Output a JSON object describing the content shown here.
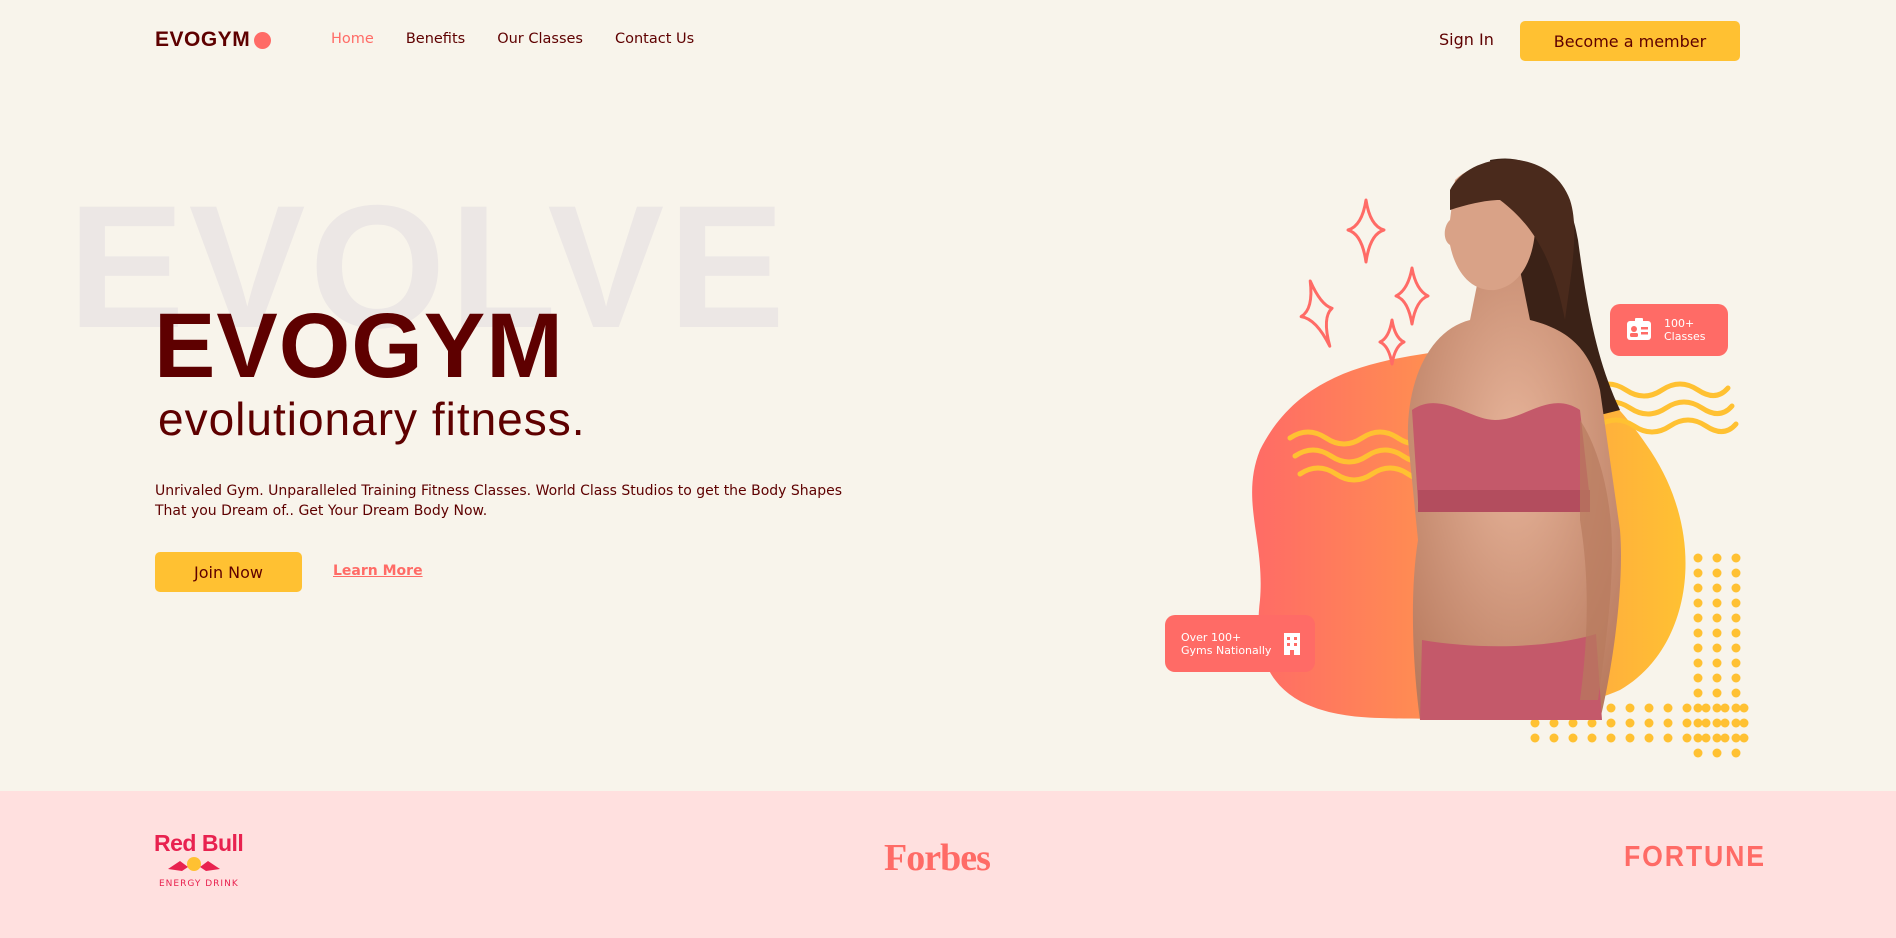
{
  "nav": {
    "logo": "EVOGYM",
    "links": [
      "Home",
      "Benefits",
      "Our Classes",
      "Contact Us"
    ],
    "active": "Home",
    "sign_in": "Sign In",
    "cta": "Become a member"
  },
  "hero": {
    "bg_word": "EVOLVE",
    "title": "EVOGYM",
    "subtitle": "evolutionary fitness.",
    "description": "Unrivaled Gym. Unparalleled Training Fitness Classes. World Class Studios to get the Body Shapes That you Dream of.. Get Your Dream Body Now.",
    "join_button": "Join Now",
    "learn_more": "Learn More"
  },
  "badges": {
    "classes_line1": "100+",
    "classes_line2": "Classes",
    "classes_icon": "id-card-icon",
    "gyms_line1": "Over 100+",
    "gyms_line2": "Gyms Nationally",
    "gyms_icon": "building-icon"
  },
  "sponsors": {
    "redbull_name": "Red Bull",
    "redbull_sub": "ENERGY DRINK",
    "forbes": "Forbes",
    "fortune": "FORTUNE"
  },
  "colors": {
    "primary_text": "#5e0000",
    "accent_coral": "#ff6b66",
    "accent_yellow": "#ffc132",
    "background": "#f8f4eb",
    "sponsor_bg": "#ffe0df"
  }
}
